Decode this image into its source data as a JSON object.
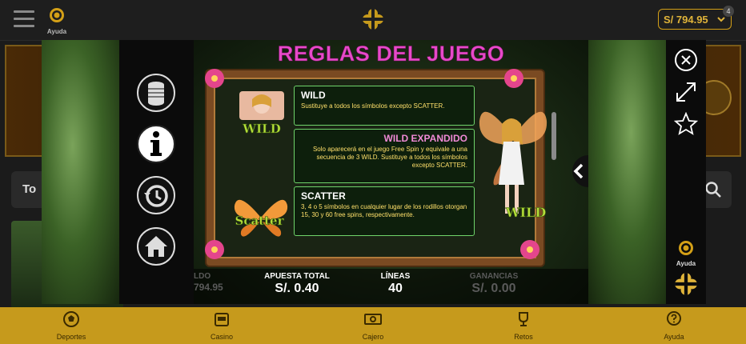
{
  "header": {
    "help_label": "Ayuda",
    "balance": "S/ 794.95",
    "badge_count": "4"
  },
  "background": {
    "search_placeholder": "To"
  },
  "modal": {
    "title": "REGLAS DEL JUEGO",
    "rules": [
      {
        "heading": "WILD",
        "text": "Sustituye a todos los símbolos excepto SCATTER."
      },
      {
        "heading": "WILD EXPANDIDO",
        "text": "Solo aparecerá en el juego Free Spin y equivale a una secuencia de 3 WILD. Sustituye a todos los símbolos excepto SCATTER."
      },
      {
        "heading": "SCATTER",
        "text": "3, 4 o 5 símbolos en cualquier lugar de los rodillos otorgan 15, 30 y 60 free spins, respectivamente."
      }
    ],
    "symbol_wild": "WILD",
    "symbol_scatter": "Scatter",
    "stats": {
      "saldo_label": "LDO",
      "saldo_value": "794.95",
      "apuesta_label": "APUESTA TOTAL",
      "apuesta_value": "S/. 0.40",
      "lineas_label": "LÍNEAS",
      "lineas_value": "40",
      "ganancias_label": "GANANCIAS",
      "ganancias_value": "S/. 0.00"
    },
    "help_label": "Ayuda"
  },
  "bottom_nav": [
    {
      "label": "Deportes",
      "icon": "soccer-ball-icon"
    },
    {
      "label": "Casino",
      "icon": "slot-machine-icon"
    },
    {
      "label": "Cajero",
      "icon": "cash-icon"
    },
    {
      "label": "Retos",
      "icon": "trophy-icon"
    },
    {
      "label": "Ayuda",
      "icon": "question-bubble-icon"
    }
  ],
  "colors": {
    "accent_gold": "#c69a1c",
    "title_pink": "#e64ac9",
    "box_green": "#6fd46a",
    "rule_text_yellow": "#ffe06a"
  }
}
